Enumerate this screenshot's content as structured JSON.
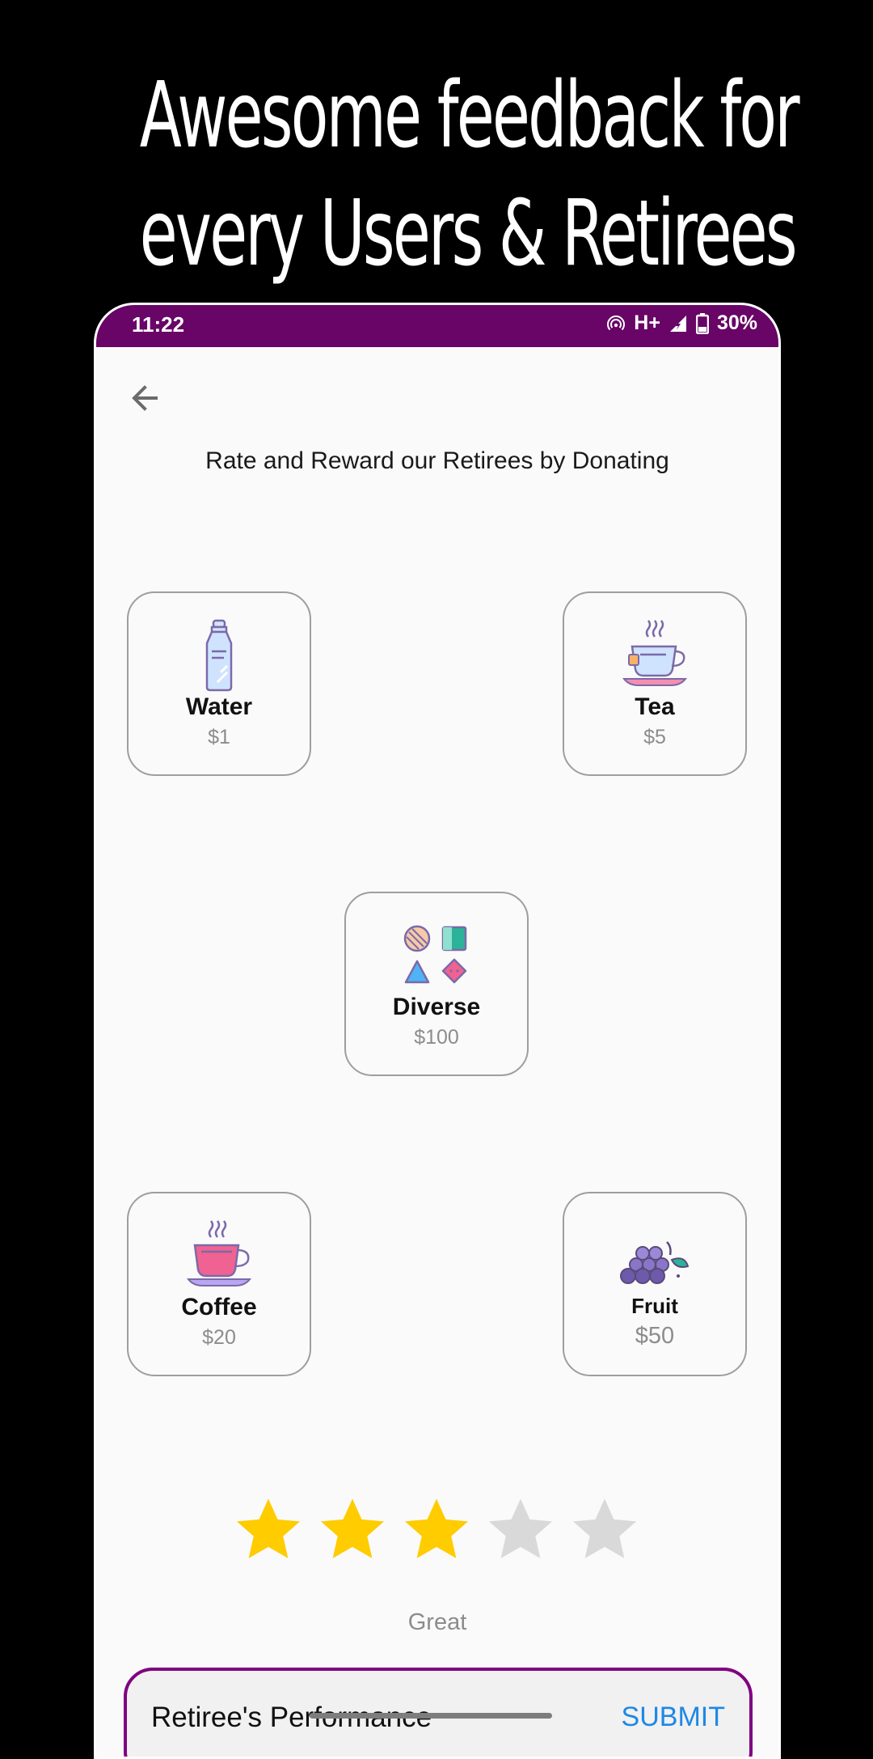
{
  "headline": {
    "line1": "Awesome feedback for",
    "line2": "every Users & Retirees"
  },
  "status_bar": {
    "time": "11:22",
    "network": "H+",
    "battery": "30%"
  },
  "page": {
    "title": "Rate and Reward our Retirees by Donating"
  },
  "items": [
    {
      "name": "Water",
      "price": "$1",
      "icon": "water-bottle-icon"
    },
    {
      "name": "Tea",
      "price": "$5",
      "icon": "tea-cup-icon"
    },
    {
      "name": "Diverse",
      "price": "$100",
      "icon": "shapes-icon"
    },
    {
      "name": "Coffee",
      "price": "$20",
      "icon": "coffee-cup-icon"
    },
    {
      "name": "Fruit",
      "price": "$50",
      "icon": "grapes-icon"
    }
  ],
  "rating": {
    "value": 3,
    "max": 5,
    "label": "Great",
    "filled_color": "#FFCC00",
    "empty_color": "#D9D9D9"
  },
  "feedback": {
    "label": "Retiree's Performance",
    "submit": "SUBMIT"
  },
  "colors": {
    "status_bar": "#680566",
    "accent_border": "#800080",
    "submit": "#1E88E5"
  }
}
